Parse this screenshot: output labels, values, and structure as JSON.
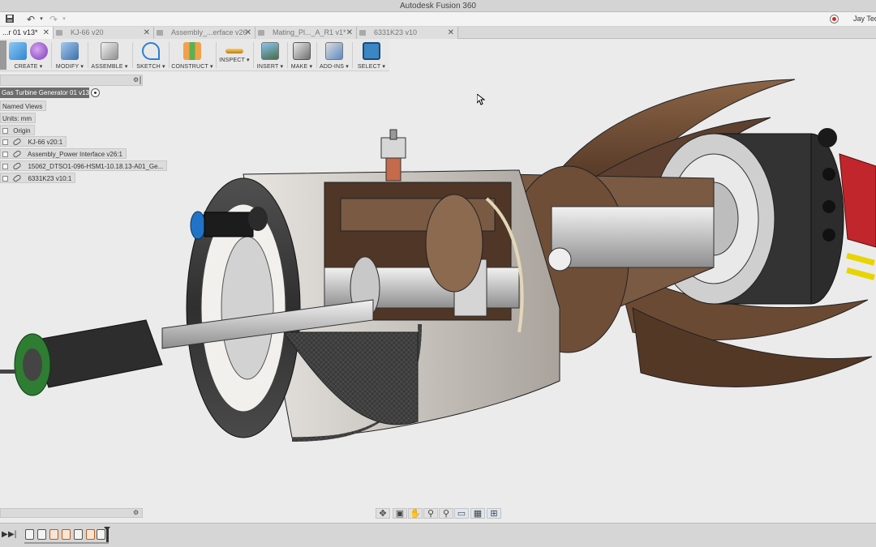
{
  "app": {
    "title": "Autodesk Fusion 360",
    "user": "Jay Teder"
  },
  "quick_access": {
    "save_icon": "save-icon",
    "undo_icon": "undo-icon",
    "redo_icon": "redo-icon"
  },
  "tabs": [
    {
      "label": "...r 01 v13*",
      "active": true
    },
    {
      "label": "KJ-66 v20",
      "active": false
    },
    {
      "label": "Assembly_...erface v26",
      "active": false
    },
    {
      "label": "Mating_Pl..._A_R1 v1*",
      "active": false
    },
    {
      "label": "6331K23 v10",
      "active": false
    }
  ],
  "toolbar": {
    "create": "CREATE ▾",
    "modify": "MODIFY ▾",
    "assemble": "ASSEMBLE ▾",
    "sketch": "SKETCH ▾",
    "construct": "CONSTRUCT ▾",
    "inspect": "INSPECT ▾",
    "insert": "INSERT ▾",
    "make": "MAKE ▾",
    "addins": "ADD-INS ▾",
    "select": "SELECT ▾"
  },
  "browser": {
    "root": "Gas Turbine Generator 01 v13",
    "named_views": "Named Views",
    "units": "Units: mm",
    "origin": "Origin",
    "items": [
      "KJ-66 v20:1",
      "Assembly_Power Interface v26:1",
      "15062_DTSO1-096-HSM1-10.18.13-A01_Ge...",
      "6331K23 v10:1"
    ]
  },
  "colors": {
    "accent": "#3c86c4",
    "titlebar": "#d4d4d4",
    "viewport": "#ebebeb",
    "model_bronze": "#6b4a33",
    "model_carbon": "#3a3a3a",
    "model_shell": "#c9c4bd",
    "motor_green": "#2e7d32",
    "plate_red": "#c0262b",
    "wire_yellow": "#e8d400",
    "nozzle_blue": "#1f74c8"
  }
}
